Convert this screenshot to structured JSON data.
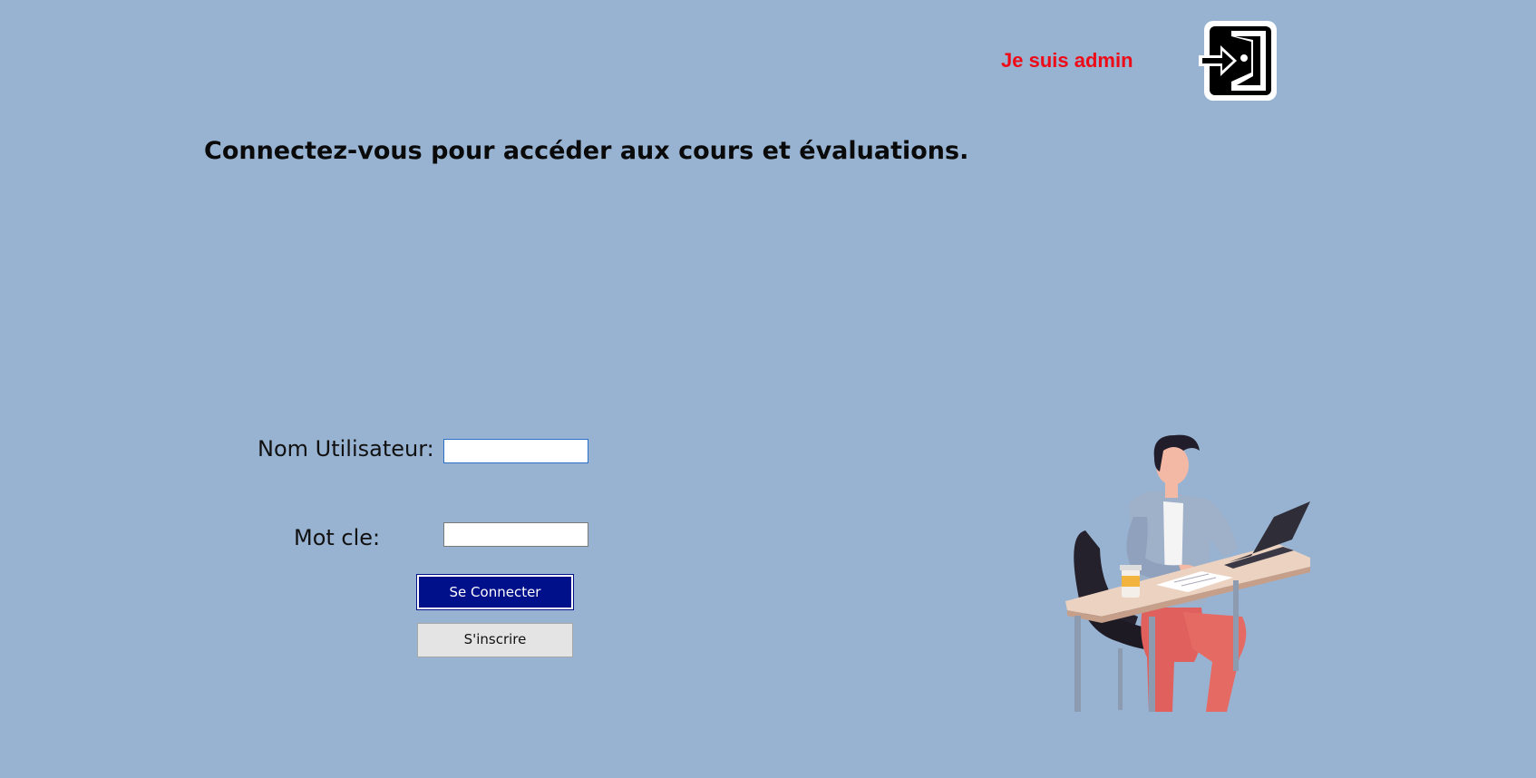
{
  "header": {
    "admin_label": "Je suis admin",
    "admin_icon": "login-door-icon"
  },
  "main": {
    "headline": "Connectez-vous pour accéder aux cours et évaluations."
  },
  "form": {
    "username_label": "Nom Utilisateur:",
    "username_value": "",
    "password_label": "Mot cle:",
    "password_value": "",
    "login_button": "Se Connecter",
    "signup_button": "S'inscrire"
  },
  "colors": {
    "background": "#98b3d1",
    "admin_text": "#ee0a16",
    "login_button_bg": "#000f8a",
    "signup_button_bg": "#e4e4e4"
  },
  "illustration": {
    "icon": "person-studying-at-desk-illustration"
  }
}
